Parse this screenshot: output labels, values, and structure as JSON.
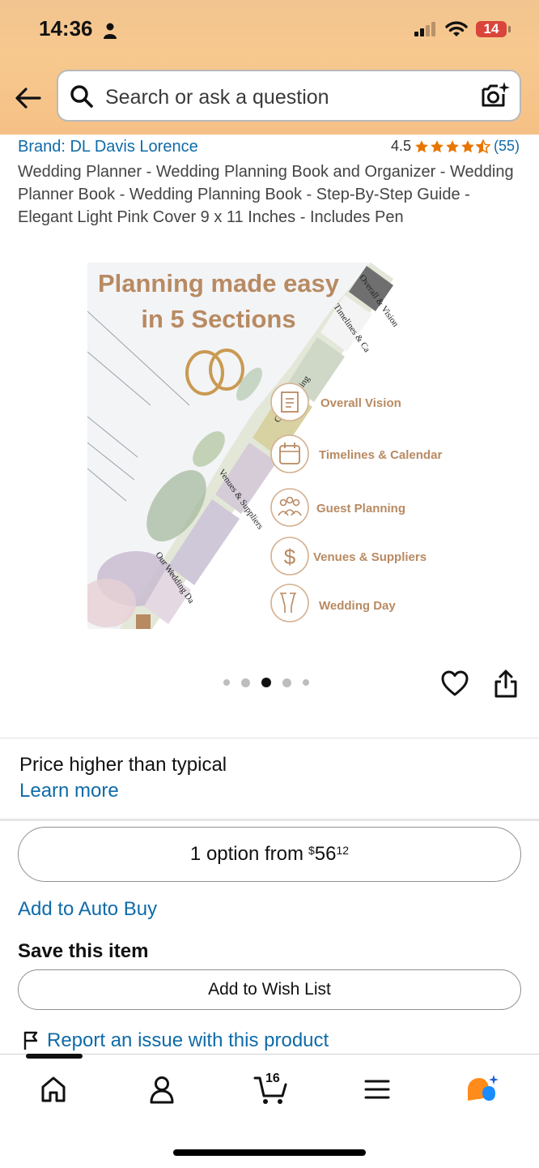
{
  "status_bar": {
    "time": "14:36",
    "battery": "14"
  },
  "search": {
    "placeholder": "Search or ask a question"
  },
  "product": {
    "brand": "Brand: DL Davis Lorence",
    "rating": "4.5",
    "rating_count": "(55)",
    "title": "Wedding Planner - Wedding Planning Book and Organizer - Wedding Planner Book - Wedding Planning Book - Step-By-Step Guide - Elegant Light Pink Cover 9 x 11 Inches - Includes Pen"
  },
  "image": {
    "headline_1": "Planning made easy",
    "headline_2": "in 5 Sections",
    "sections": [
      "Overall Vision",
      "Timelines & Calendar",
      "Guest Planning",
      "Venues & Suppliers",
      "Wedding Day"
    ],
    "tabs": [
      "Overall & Vision",
      "Timelines & Ca",
      "Guest Planning",
      "Venues & Suppliers",
      "Our Wedding Da"
    ],
    "accent": "#b88a62",
    "page_index": 3,
    "page_count": 5
  },
  "price_note": {
    "text": "Price higher than typical",
    "link": "Learn more"
  },
  "buy": {
    "option_text": "1 option from",
    "currency": "$",
    "whole": "56",
    "fraction": "12"
  },
  "auto_buy": "Add to Auto Buy",
  "save": {
    "title": "Save this item",
    "wish_list": "Add to Wish List"
  },
  "report": "Report an issue with this product",
  "tabbar": {
    "cart_count": "16"
  },
  "colors": {
    "header": "#f7c98f",
    "link": "#0f6ba8",
    "star": "#e77600",
    "battery": "#d9453a"
  }
}
